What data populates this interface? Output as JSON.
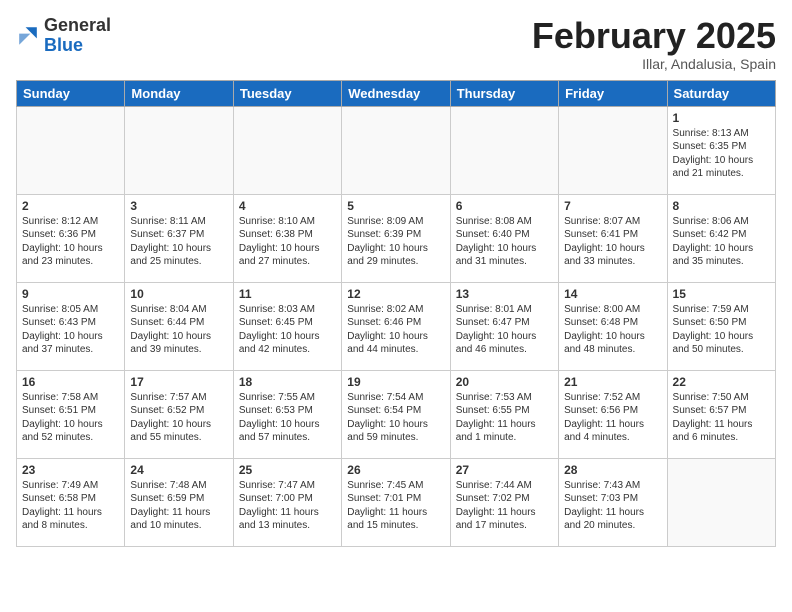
{
  "header": {
    "logo_general": "General",
    "logo_blue": "Blue",
    "title": "February 2025",
    "subtitle": "Illar, Andalusia, Spain"
  },
  "weekdays": [
    "Sunday",
    "Monday",
    "Tuesday",
    "Wednesday",
    "Thursday",
    "Friday",
    "Saturday"
  ],
  "weeks": [
    [
      {
        "day": "",
        "info": ""
      },
      {
        "day": "",
        "info": ""
      },
      {
        "day": "",
        "info": ""
      },
      {
        "day": "",
        "info": ""
      },
      {
        "day": "",
        "info": ""
      },
      {
        "day": "",
        "info": ""
      },
      {
        "day": "1",
        "info": "Sunrise: 8:13 AM\nSunset: 6:35 PM\nDaylight: 10 hours\nand 21 minutes."
      }
    ],
    [
      {
        "day": "2",
        "info": "Sunrise: 8:12 AM\nSunset: 6:36 PM\nDaylight: 10 hours\nand 23 minutes."
      },
      {
        "day": "3",
        "info": "Sunrise: 8:11 AM\nSunset: 6:37 PM\nDaylight: 10 hours\nand 25 minutes."
      },
      {
        "day": "4",
        "info": "Sunrise: 8:10 AM\nSunset: 6:38 PM\nDaylight: 10 hours\nand 27 minutes."
      },
      {
        "day": "5",
        "info": "Sunrise: 8:09 AM\nSunset: 6:39 PM\nDaylight: 10 hours\nand 29 minutes."
      },
      {
        "day": "6",
        "info": "Sunrise: 8:08 AM\nSunset: 6:40 PM\nDaylight: 10 hours\nand 31 minutes."
      },
      {
        "day": "7",
        "info": "Sunrise: 8:07 AM\nSunset: 6:41 PM\nDaylight: 10 hours\nand 33 minutes."
      },
      {
        "day": "8",
        "info": "Sunrise: 8:06 AM\nSunset: 6:42 PM\nDaylight: 10 hours\nand 35 minutes."
      }
    ],
    [
      {
        "day": "9",
        "info": "Sunrise: 8:05 AM\nSunset: 6:43 PM\nDaylight: 10 hours\nand 37 minutes."
      },
      {
        "day": "10",
        "info": "Sunrise: 8:04 AM\nSunset: 6:44 PM\nDaylight: 10 hours\nand 39 minutes."
      },
      {
        "day": "11",
        "info": "Sunrise: 8:03 AM\nSunset: 6:45 PM\nDaylight: 10 hours\nand 42 minutes."
      },
      {
        "day": "12",
        "info": "Sunrise: 8:02 AM\nSunset: 6:46 PM\nDaylight: 10 hours\nand 44 minutes."
      },
      {
        "day": "13",
        "info": "Sunrise: 8:01 AM\nSunset: 6:47 PM\nDaylight: 10 hours\nand 46 minutes."
      },
      {
        "day": "14",
        "info": "Sunrise: 8:00 AM\nSunset: 6:48 PM\nDaylight: 10 hours\nand 48 minutes."
      },
      {
        "day": "15",
        "info": "Sunrise: 7:59 AM\nSunset: 6:50 PM\nDaylight: 10 hours\nand 50 minutes."
      }
    ],
    [
      {
        "day": "16",
        "info": "Sunrise: 7:58 AM\nSunset: 6:51 PM\nDaylight: 10 hours\nand 52 minutes."
      },
      {
        "day": "17",
        "info": "Sunrise: 7:57 AM\nSunset: 6:52 PM\nDaylight: 10 hours\nand 55 minutes."
      },
      {
        "day": "18",
        "info": "Sunrise: 7:55 AM\nSunset: 6:53 PM\nDaylight: 10 hours\nand 57 minutes."
      },
      {
        "day": "19",
        "info": "Sunrise: 7:54 AM\nSunset: 6:54 PM\nDaylight: 10 hours\nand 59 minutes."
      },
      {
        "day": "20",
        "info": "Sunrise: 7:53 AM\nSunset: 6:55 PM\nDaylight: 11 hours\nand 1 minute."
      },
      {
        "day": "21",
        "info": "Sunrise: 7:52 AM\nSunset: 6:56 PM\nDaylight: 11 hours\nand 4 minutes."
      },
      {
        "day": "22",
        "info": "Sunrise: 7:50 AM\nSunset: 6:57 PM\nDaylight: 11 hours\nand 6 minutes."
      }
    ],
    [
      {
        "day": "23",
        "info": "Sunrise: 7:49 AM\nSunset: 6:58 PM\nDaylight: 11 hours\nand 8 minutes."
      },
      {
        "day": "24",
        "info": "Sunrise: 7:48 AM\nSunset: 6:59 PM\nDaylight: 11 hours\nand 10 minutes."
      },
      {
        "day": "25",
        "info": "Sunrise: 7:47 AM\nSunset: 7:00 PM\nDaylight: 11 hours\nand 13 minutes."
      },
      {
        "day": "26",
        "info": "Sunrise: 7:45 AM\nSunset: 7:01 PM\nDaylight: 11 hours\nand 15 minutes."
      },
      {
        "day": "27",
        "info": "Sunrise: 7:44 AM\nSunset: 7:02 PM\nDaylight: 11 hours\nand 17 minutes."
      },
      {
        "day": "28",
        "info": "Sunrise: 7:43 AM\nSunset: 7:03 PM\nDaylight: 11 hours\nand 20 minutes."
      },
      {
        "day": "",
        "info": ""
      }
    ]
  ]
}
